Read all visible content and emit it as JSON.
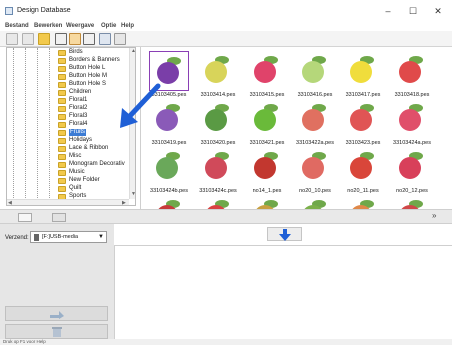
{
  "window": {
    "title": "Design Database",
    "controls": {
      "minimize": "–",
      "maximize": "☐",
      "close": "✕"
    }
  },
  "menu": [
    "Bestand",
    "Bewerken",
    "Weergave",
    "Optie",
    "Help"
  ],
  "toolbar": {
    "icons": [
      "cut-icon",
      "copy-icon",
      "folder-open-icon",
      "view-large-icon",
      "view-medium-icon",
      "view-small-icon",
      "import-icon",
      "print-icon"
    ]
  },
  "tree": {
    "folders": [
      "Birds",
      "Borders & Banners",
      "Button Hole L",
      "Button Hole M",
      "Button Hole S",
      "Children",
      "Floral1",
      "Floral2",
      "Floral3",
      "Floral4",
      "Fruits",
      "Holidays",
      "Lace & Ribbon",
      "Misc",
      "Monogram Decorativ",
      "Music",
      "New Folder",
      "Quilt",
      "Sports"
    ],
    "selected": "Fruits"
  },
  "grid": {
    "files": [
      "33103405.pes",
      "33103414.pes",
      "33103415.pes",
      "33103416.pes",
      "33103417.pes",
      "33103418.pes",
      "33103419.pes",
      "33103420.pes",
      "33103421.pes",
      "33103422a.pes",
      "33103423.pes",
      "33103424a.pes",
      "33103424b.pes",
      "33103424c.pes",
      "no14_1.pes",
      "no20_10.pes",
      "no20_11.pes",
      "no20_12.pes",
      "",
      "",
      "",
      "",
      "",
      ""
    ],
    "selected_index": 0,
    "fruit_colors": [
      "#7a3ea8",
      "#d8d45a",
      "#e0436a",
      "#b5d77a",
      "#f0dd3c",
      "#e04a4a",
      "#8a5ab8",
      "#5a9a44",
      "#6aba3a",
      "#e07060",
      "#e05555",
      "#e04f6a",
      "#6aa85a",
      "#d04a5a",
      "#c2372f",
      "#e06a62",
      "#d9463a",
      "#d8405a",
      "#c73a3a",
      "#d94242",
      "#c8a040",
      "#7bb04a",
      "#e08848",
      "#d04848"
    ]
  },
  "lower": {
    "send_label": "Verzend:",
    "send_value": "[F:]USB-media"
  },
  "status": "Druk op F1 voor Help"
}
